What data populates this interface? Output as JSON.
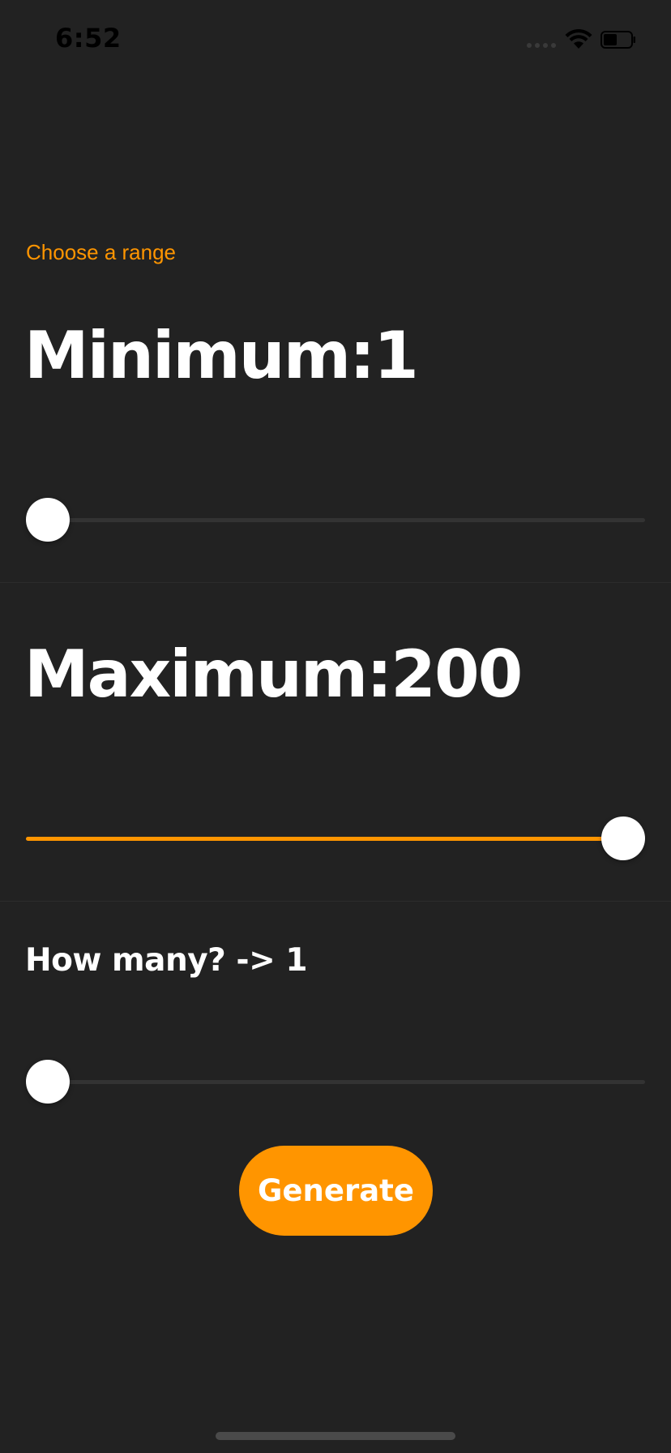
{
  "status_bar": {
    "time": "6:52"
  },
  "range": {
    "section_label": "Choose a range",
    "minimum": {
      "title": "Minimum:1",
      "value": 1,
      "min": 1,
      "max": 200
    },
    "maximum": {
      "title": "Maximum:200",
      "value": 200,
      "min": 1,
      "max": 200
    }
  },
  "count": {
    "title": "How many? -> 1",
    "value": 1,
    "min": 1,
    "max": 200
  },
  "actions": {
    "generate_label": "Generate"
  },
  "colors": {
    "accent": "#FF9500",
    "background": "#222222",
    "text": "#ffffff"
  },
  "icons": {
    "signal": "cellular-signal-icon",
    "wifi": "wifi-icon",
    "battery": "battery-icon"
  }
}
